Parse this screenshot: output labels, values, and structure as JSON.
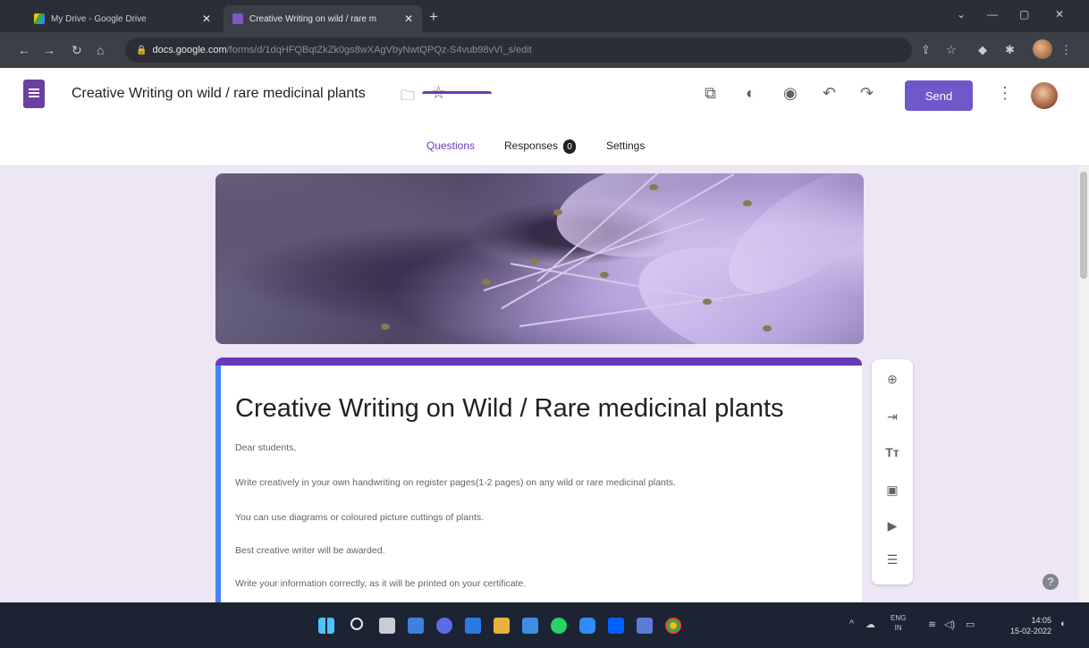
{
  "browser": {
    "tabs": [
      {
        "title": "My Drive - Google Drive",
        "active": false
      },
      {
        "title": "Creative Writing on wild / rare m",
        "active": true
      }
    ],
    "url_domain": "docs.google.com",
    "url_path": "/forms/d/1dqHFQBqtZkZk0gs8wXAgVbyNwtQPQz-S4vub98vVI_s/edit"
  },
  "header": {
    "doc_title": "Creative Writing on wild / rare medicinal plants",
    "send_label": "Send"
  },
  "form_tabs": [
    {
      "label": "Questions",
      "active": true
    },
    {
      "label": "Responses",
      "badge": "0"
    },
    {
      "label": "Settings"
    }
  ],
  "form": {
    "title": "Creative Writing on Wild / Rare medicinal plants",
    "description": [
      "Dear students,",
      "Write creatively in your own handwriting on register pages(1-2 pages) on any wild or rare medicinal plants.",
      "You can use diagrams or coloured picture cuttings of plants.",
      "Best creative writer will be awarded.",
      "Write your information correctly, as it will be printed on your certificate."
    ]
  },
  "toolbar_icons": [
    "add-question-icon",
    "import-questions-icon",
    "add-title-icon",
    "add-image-icon",
    "add-video-icon",
    "add-section-icon"
  ],
  "taskbar": {
    "lang": "ENG",
    "region": "IN",
    "time": "14:05",
    "date": "15-02-2022"
  },
  "colors": {
    "accent": "#673ab7",
    "send_button": "#6f58c9",
    "page_bg": "#ede7f5"
  }
}
